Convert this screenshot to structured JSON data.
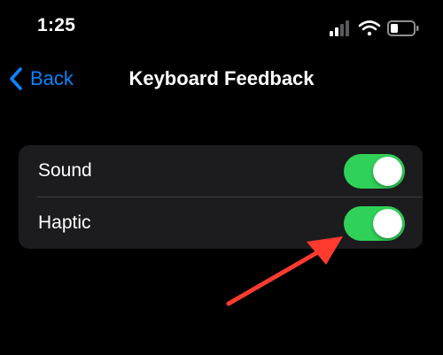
{
  "status_bar": {
    "time": "1:25",
    "icons": [
      "cellular-signal-icon",
      "wifi-icon",
      "battery-icon"
    ]
  },
  "nav": {
    "back_label": "Back",
    "title": "Keyboard Feedback"
  },
  "settings": {
    "rows": [
      {
        "label": "Sound",
        "enabled": true
      },
      {
        "label": "Haptic",
        "enabled": true
      }
    ]
  },
  "colors": {
    "background": "#000000",
    "group_background": "#1c1c1e",
    "accent_blue": "#0a84ff",
    "toggle_on": "#30d158",
    "annotation_arrow": "#ff3b30"
  }
}
